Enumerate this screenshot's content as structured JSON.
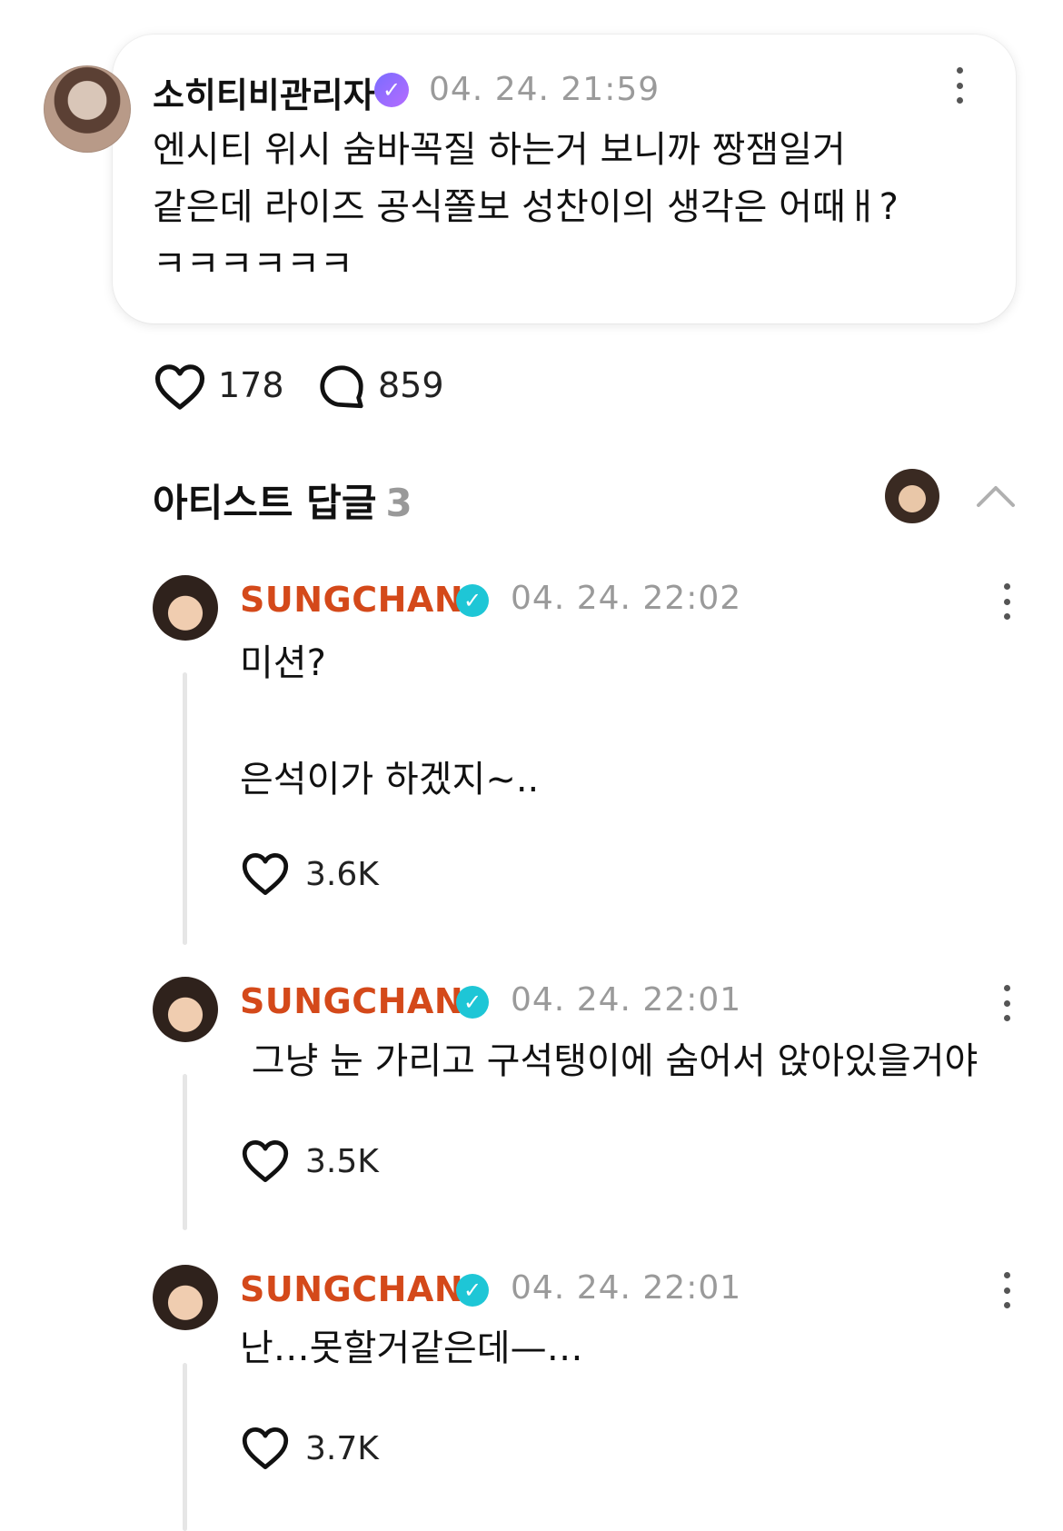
{
  "post": {
    "author": "소히티비관리자",
    "time": "04. 24. 21:59",
    "text": "엔시티 위시 숨바꼭질 하는거 보니까 짱잼일거\n같은데 라이즈 공식쫄보 성찬이의 생각은 어때ㅐ?\nㅋㅋㅋㅋㅋㅋ",
    "likes": "178",
    "comments": "859"
  },
  "artist_replies": {
    "title": "아티스트 답글",
    "count": "3"
  },
  "replies": [
    {
      "author": "SUNGCHAN",
      "time": "04. 24. 22:02",
      "text": "미션?\n\n은석이가 하겠지~..",
      "likes": "3.6K"
    },
    {
      "author": "SUNGCHAN",
      "time": "04. 24. 22:01",
      "text": " 그냥 눈 가리고 구석탱이에 숨어서 앉아있을거야",
      "likes": "3.5K"
    },
    {
      "author": "SUNGCHAN",
      "time": "04. 24. 22:01",
      "text": "난…못할거같은데—…",
      "likes": "3.7K"
    }
  ],
  "colors": {
    "artist_name": "#d4491a",
    "verified_artist": "#1ec6d6",
    "verified_user": "#8a6cff",
    "muted": "#9a9a9a"
  },
  "icons": {
    "heart": "heart-icon",
    "comment": "comment-icon",
    "more": "more-vertical-icon",
    "collapse": "chevron-up-icon",
    "verified": "verified-badge-icon"
  }
}
